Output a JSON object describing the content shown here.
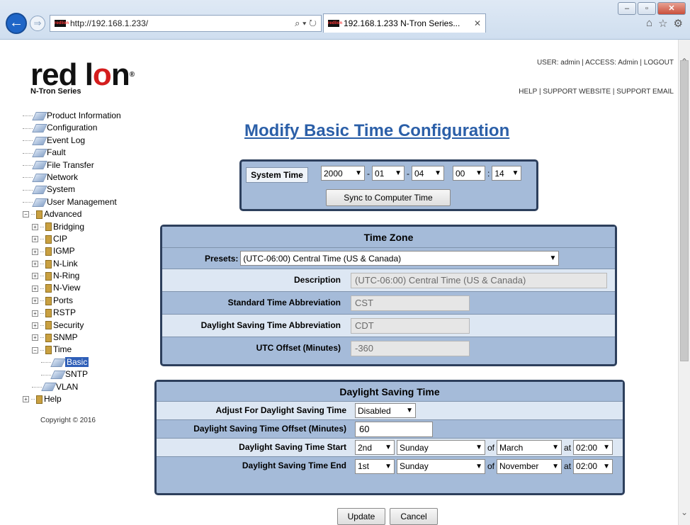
{
  "browser": {
    "url": "http://192.168.1.233/",
    "tab_title": "192.168.1.233 N-Tron Series...",
    "favicon_text": "redlion"
  },
  "header": {
    "logo_text_1": "red l",
    "logo_text_o": "o",
    "logo_text_2": "n",
    "logo_series": "N-Tron Series",
    "user_bar": "USER: admin | ACCESS: Admin | LOGOUT",
    "help_bar": "HELP | SUPPORT WEBSITE | SUPPORT EMAIL"
  },
  "tree": [
    {
      "label": "Product Information",
      "type": "page",
      "indent": 0
    },
    {
      "label": "Configuration",
      "type": "page",
      "indent": 0
    },
    {
      "label": "Event Log",
      "type": "page",
      "indent": 0
    },
    {
      "label": "Fault",
      "type": "page",
      "indent": 0
    },
    {
      "label": "File Transfer",
      "type": "page",
      "indent": 0
    },
    {
      "label": "Network",
      "type": "page",
      "indent": 0
    },
    {
      "label": "System",
      "type": "page",
      "indent": 0
    },
    {
      "label": "User Management",
      "type": "page",
      "indent": 0
    },
    {
      "label": "Advanced",
      "type": "folder-open",
      "indent": 0
    },
    {
      "label": "Bridging",
      "type": "folder",
      "indent": 1
    },
    {
      "label": "CIP",
      "type": "folder",
      "indent": 1
    },
    {
      "label": "IGMP",
      "type": "folder",
      "indent": 1
    },
    {
      "label": "N-Link",
      "type": "folder",
      "indent": 1
    },
    {
      "label": "N-Ring",
      "type": "folder",
      "indent": 1
    },
    {
      "label": "N-View",
      "type": "folder",
      "indent": 1
    },
    {
      "label": "Ports",
      "type": "folder",
      "indent": 1
    },
    {
      "label": "RSTP",
      "type": "folder",
      "indent": 1
    },
    {
      "label": "Security",
      "type": "folder",
      "indent": 1
    },
    {
      "label": "SNMP",
      "type": "folder",
      "indent": 1
    },
    {
      "label": "Time",
      "type": "folder-open",
      "indent": 1
    },
    {
      "label": "Basic",
      "type": "page-selected",
      "indent": 2
    },
    {
      "label": "SNTP",
      "type": "page",
      "indent": 2
    },
    {
      "label": "VLAN",
      "type": "page",
      "indent": 1
    },
    {
      "label": "Help",
      "type": "folder",
      "indent": 0
    }
  ],
  "copyright": "Copyright © 2016",
  "page_title": "Modify Basic Time Configuration",
  "system_time": {
    "label": "System Time",
    "year": "2000",
    "month": "01",
    "day": "04",
    "hour": "00",
    "minute": "14",
    "sync_button": "Sync to Computer Time"
  },
  "time_zone": {
    "title": "Time Zone",
    "presets_label": "Presets:",
    "presets_value": "(UTC-06:00) Central Time (US & Canada)",
    "description_label": "Description",
    "description_value": "(UTC-06:00) Central Time (US & Canada)",
    "std_abbr_label": "Standard Time Abbreviation",
    "std_abbr_value": "CST",
    "dst_abbr_label": "Daylight Saving Time Abbreviation",
    "dst_abbr_value": "CDT",
    "utc_offset_label": "UTC Offset (Minutes)",
    "utc_offset_value": "-360"
  },
  "dst": {
    "title": "Daylight Saving Time",
    "adjust_label": "Adjust For Daylight Saving Time",
    "adjust_value": "Disabled",
    "offset_label": "Daylight Saving Time Offset (Minutes)",
    "offset_value": "60",
    "start_label": "Daylight Saving Time Start",
    "start_week": "2nd",
    "start_day": "Sunday",
    "start_month": "March",
    "start_time": "02:00",
    "end_label": "Daylight Saving Time End",
    "end_week": "1st",
    "end_day": "Sunday",
    "end_month": "November",
    "end_time": "02:00",
    "of_text": "of",
    "at_text": "at"
  },
  "actions": {
    "update": "Update",
    "cancel": "Cancel"
  }
}
